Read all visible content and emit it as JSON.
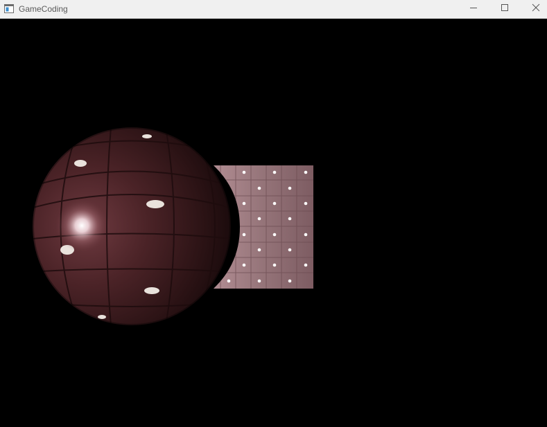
{
  "window": {
    "title": "GameCoding",
    "icons": {
      "app": "app-window-icon",
      "minimize": "minimize-icon",
      "maximize": "maximize-icon",
      "close": "close-icon"
    }
  },
  "colors": {
    "titlebar": "#f0f0f0",
    "title_text": "#5a5a5a",
    "scene_background": "#000000",
    "sphere_base": "#4a2226",
    "panel_base": "#8d6d72",
    "highlight": "#ffffff"
  }
}
